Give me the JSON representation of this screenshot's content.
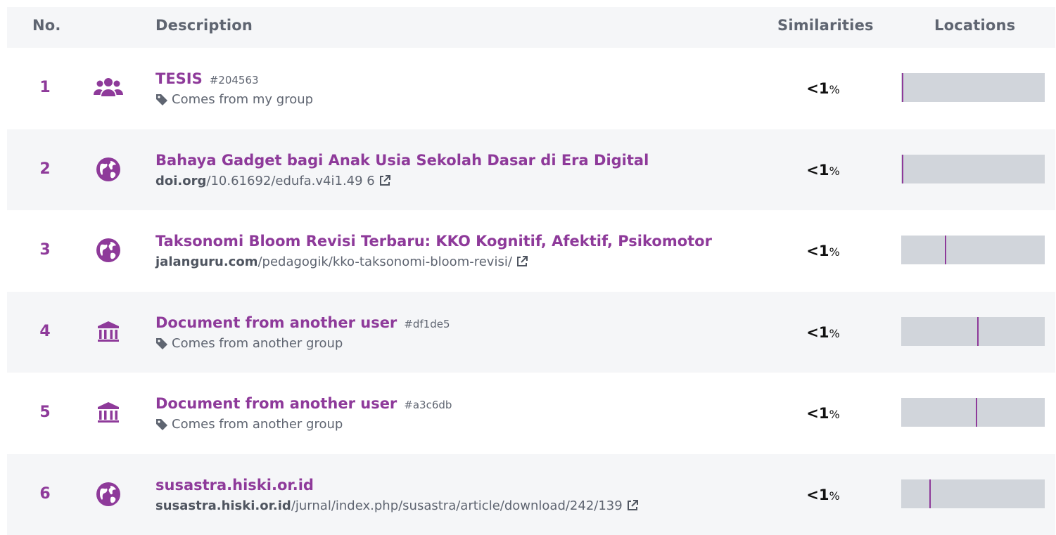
{
  "header": {
    "no": "No.",
    "description": "Description",
    "similarities": "Similarities",
    "locations": "Locations"
  },
  "colors": {
    "accent": "#8e3a9a",
    "row_shade": "#f5f6f8",
    "bar": "#d1d5db",
    "muted_text": "#5f6571"
  },
  "rows": [
    {
      "no": "1",
      "icon": "group-icon",
      "title": "TESIS",
      "hash": "#204563",
      "sub_kind": "tag",
      "sub_text": "Comes from my group",
      "similarity": "<1",
      "similarity_unit": "%",
      "location_fraction": 0.005
    },
    {
      "no": "2",
      "icon": "globe-icon",
      "title": "Bahaya Gadget bagi Anak Usia Sekolah Dasar di Era Digital",
      "hash": "",
      "sub_kind": "link",
      "sub_domain": "doi.org",
      "sub_path": "/10.61692/edufa.v4i1.49 6",
      "similarity": "<1",
      "similarity_unit": "%",
      "location_fraction": 0.005
    },
    {
      "no": "3",
      "icon": "globe-icon",
      "title": "Taksonomi Bloom Revisi Terbaru: KKO Kognitif, Afektif, Psikomotor",
      "hash": "",
      "sub_kind": "link",
      "sub_domain": "jalanguru.com",
      "sub_path": "/pedagogik/kko-taksonomi-bloom-revisi/",
      "similarity": "<1",
      "similarity_unit": "%",
      "location_fraction": 0.305
    },
    {
      "no": "4",
      "icon": "institution-icon",
      "title": "Document from another user",
      "hash": "#df1de5",
      "sub_kind": "tag",
      "sub_text": "Comes from another group",
      "similarity": "<1",
      "similarity_unit": "%",
      "location_fraction": 0.53
    },
    {
      "no": "5",
      "icon": "institution-icon",
      "title": "Document from another user",
      "hash": "#a3c6db",
      "sub_kind": "tag",
      "sub_text": "Comes from another group",
      "similarity": "<1",
      "similarity_unit": "%",
      "location_fraction": 0.52
    },
    {
      "no": "6",
      "icon": "globe-icon",
      "title": "susastra.hiski.or.id",
      "hash": "",
      "sub_kind": "link",
      "sub_domain": "susastra.hiski.or.id",
      "sub_path": "/jurnal/index.php/susastra/article/download/242/139",
      "similarity": "<1",
      "similarity_unit": "%",
      "location_fraction": 0.195
    }
  ]
}
